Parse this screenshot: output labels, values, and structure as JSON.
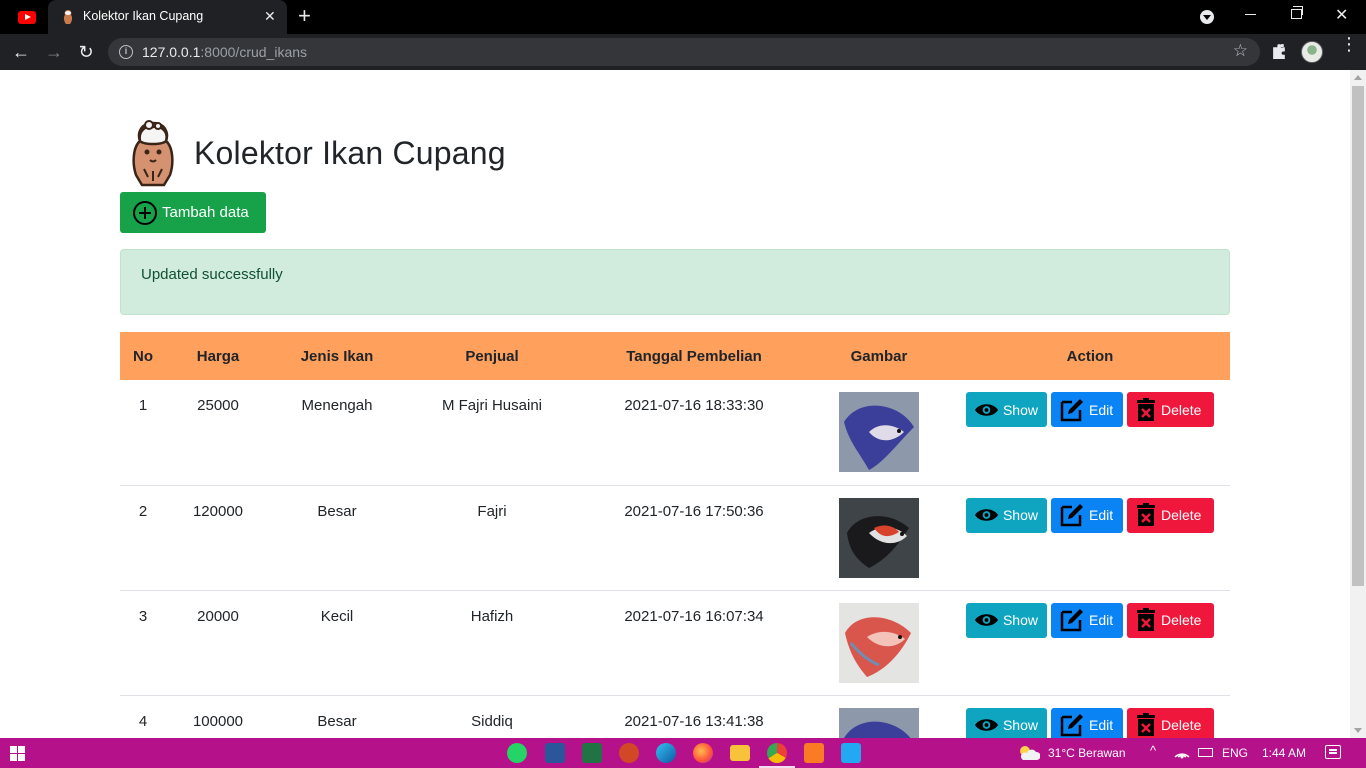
{
  "browser": {
    "tab_title": "Kolektor Ikan Cupang",
    "url_host": "127.0.0.1",
    "url_path": ":8000/crud_ikans",
    "colors": {
      "titlebar": "#000000",
      "toolbar": "#202124",
      "youtube": "#ff0000"
    }
  },
  "page": {
    "title": "Kolektor Ikan Cupang",
    "add_button_label": "Tambah data",
    "alert_message": "Updated successfully",
    "colors": {
      "header_row": "#ffa05c",
      "add_button": "#17a24a",
      "alert_bg": "#d1ecdd",
      "show": "#0fa5c0",
      "edit": "#0a84f5",
      "delete": "#f0173c"
    }
  },
  "table": {
    "headers": [
      "No",
      "Harga",
      "Jenis Ikan",
      "Penjual",
      "Tanggal Pembelian",
      "Gambar",
      "Action"
    ],
    "rows": [
      {
        "no": "1",
        "harga": "25000",
        "jenis": "Menengah",
        "penjual": "M Fajri Husaini",
        "tanggal": "2021-07-16 18:33:30"
      },
      {
        "no": "2",
        "harga": "120000",
        "jenis": "Besar",
        "penjual": "Fajri",
        "tanggal": "2021-07-16 17:50:36"
      },
      {
        "no": "3",
        "harga": "20000",
        "jenis": "Kecil",
        "penjual": "Hafizh",
        "tanggal": "2021-07-16 16:07:34"
      },
      {
        "no": "4",
        "harga": "100000",
        "jenis": "Besar",
        "penjual": "Siddiq",
        "tanggal": "2021-07-16 13:41:38"
      }
    ],
    "actions": {
      "show": "Show",
      "edit": "Edit",
      "delete": "Delete"
    }
  },
  "taskbar": {
    "weather": "31°C  Berawan",
    "language": "ENG",
    "time": "1:44 AM",
    "apps": [
      "whatsapp-icon",
      "word-icon",
      "excel-icon",
      "powerpoint-icon",
      "edge-icon",
      "firefox-icon",
      "file-explorer-icon",
      "chrome-icon",
      "xampp-icon",
      "vscode-icon"
    ],
    "color": "#b4118b"
  }
}
